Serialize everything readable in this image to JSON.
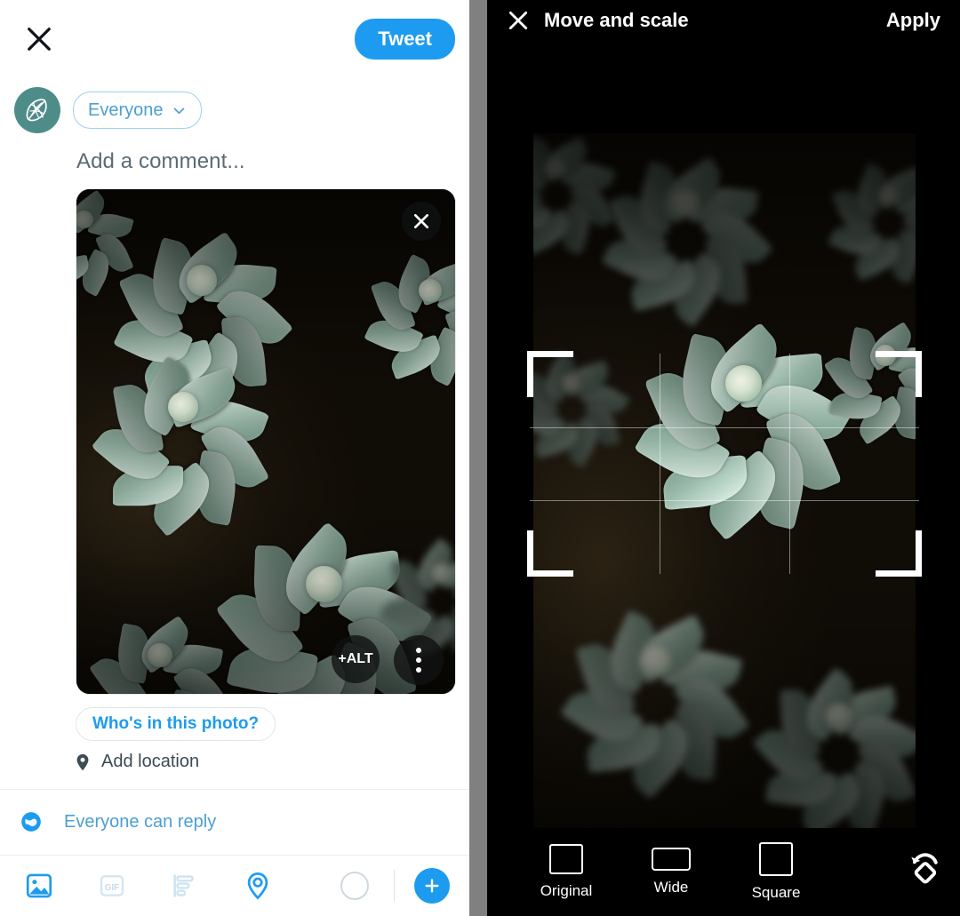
{
  "compose": {
    "close_icon": "close-icon",
    "tweet_button": "Tweet",
    "avatar_icon": "leaf-globe-avatar-icon",
    "audience": {
      "label": "Everyone",
      "chevron_icon": "chevron-down-icon"
    },
    "comment_placeholder": "Add a comment...",
    "media": {
      "remove_icon": "close-icon",
      "alt_badge": "+ALT",
      "more_icon": "more-options-icon",
      "image_alt": "Close-up photograph of pale green succulent rosettes"
    },
    "tag_people_button": "Who's in this photo?",
    "add_location": {
      "label": "Add location",
      "icon": "location-pin-icon"
    },
    "reply_setting": {
      "label": "Everyone can reply",
      "icon": "globe-icon"
    },
    "toolbar": {
      "items": [
        {
          "name": "media-icon",
          "label": "Media",
          "state": "active"
        },
        {
          "name": "gif-icon",
          "label": "GIF",
          "state": "disabled"
        },
        {
          "name": "poll-icon",
          "label": "Poll",
          "state": "disabled"
        },
        {
          "name": "location-icon",
          "label": "Location",
          "state": "active"
        }
      ],
      "gif_text": "GIF",
      "char_progress_icon": "character-count-ring",
      "add_tweet_icon": "plus-icon"
    }
  },
  "editor": {
    "close_icon": "close-icon",
    "title": "Move and scale",
    "apply_button": "Apply",
    "crop_overlay": {
      "grid": "rule-of-thirds",
      "corner_handles": 4
    },
    "ratios": [
      {
        "label": "Original",
        "shape": "sh-original",
        "selected": false
      },
      {
        "label": "Wide",
        "shape": "sh-wide",
        "selected": true
      },
      {
        "label": "Square",
        "shape": "sh-square",
        "selected": false
      }
    ],
    "rotate_icon": "rotate-icon"
  },
  "colors": {
    "twitter_blue": "#1d9bf0",
    "chip_blue": "#4a9fd4",
    "avatar_teal": "#4e8c8a",
    "divider_gray": "#808080",
    "editor_bg": "#000000",
    "panel_bg": "#ffffff"
  }
}
